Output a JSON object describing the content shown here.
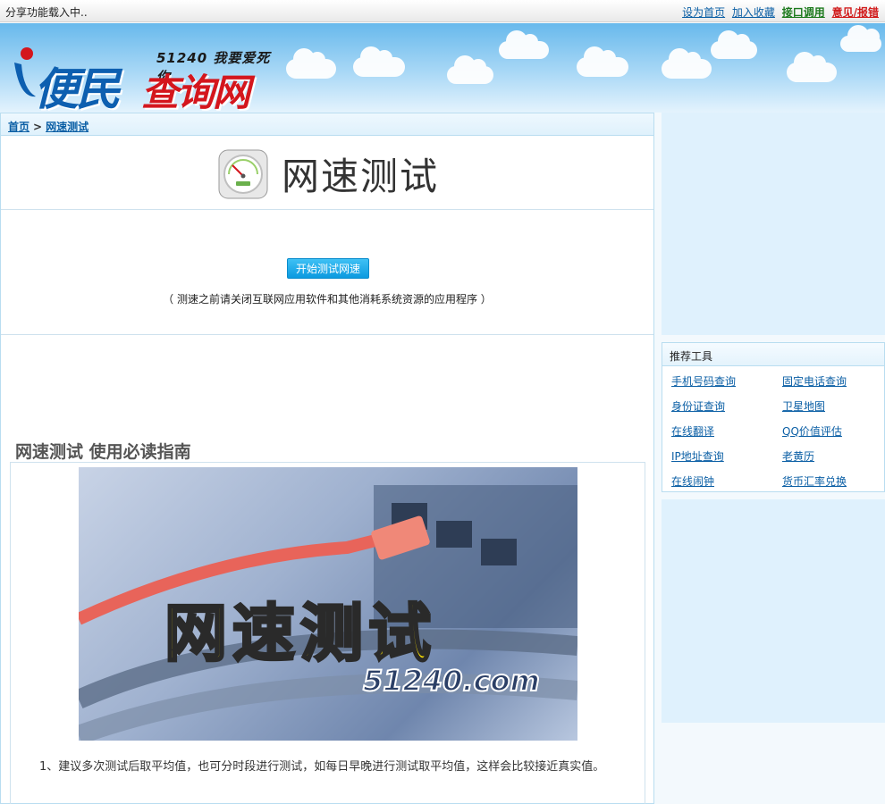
{
  "topbar": {
    "share_status": "分享功能载入中..",
    "links": {
      "set_home": "设为首页",
      "bookmark": "加入收藏",
      "api": "接口调用",
      "report": "意见/报错"
    }
  },
  "logo": {
    "slogan": "51240 我要爱死你",
    "name_part1": "便民",
    "name_part2": "查询网"
  },
  "breadcrumb": {
    "home": "首页",
    "separator": ">",
    "current": "网速测试"
  },
  "main": {
    "title": "网速测试",
    "start_button": "开始测试网速",
    "notice": "（ 测速之前请关闭互联网应用软件和其他消耗系统资源的应用程序 ）",
    "guide_title": "网速测试 使用必读指南",
    "banner": {
      "text": "网速测试",
      "url": "51240.com"
    },
    "guide_paragraph": "1、建议多次测试后取平均值，也可分时段进行测试，如每日早晚进行测试取平均值，这样会比较接近真实值。"
  },
  "sidebar": {
    "tools_title": "推荐工具",
    "tools": [
      "手机号码查询",
      "固定电话查询",
      "身份证查询",
      "卫星地图",
      "在线翻译",
      "QQ价值评估",
      "IP地址查询",
      "老黄历",
      "在线闹钟",
      "货币汇率兑换"
    ]
  },
  "colors": {
    "link": "#0b5fa5",
    "api_link": "#1d7a1d",
    "report_link": "#d11b1b",
    "button": "#0b9ae0",
    "border": "#b9ddf0"
  }
}
